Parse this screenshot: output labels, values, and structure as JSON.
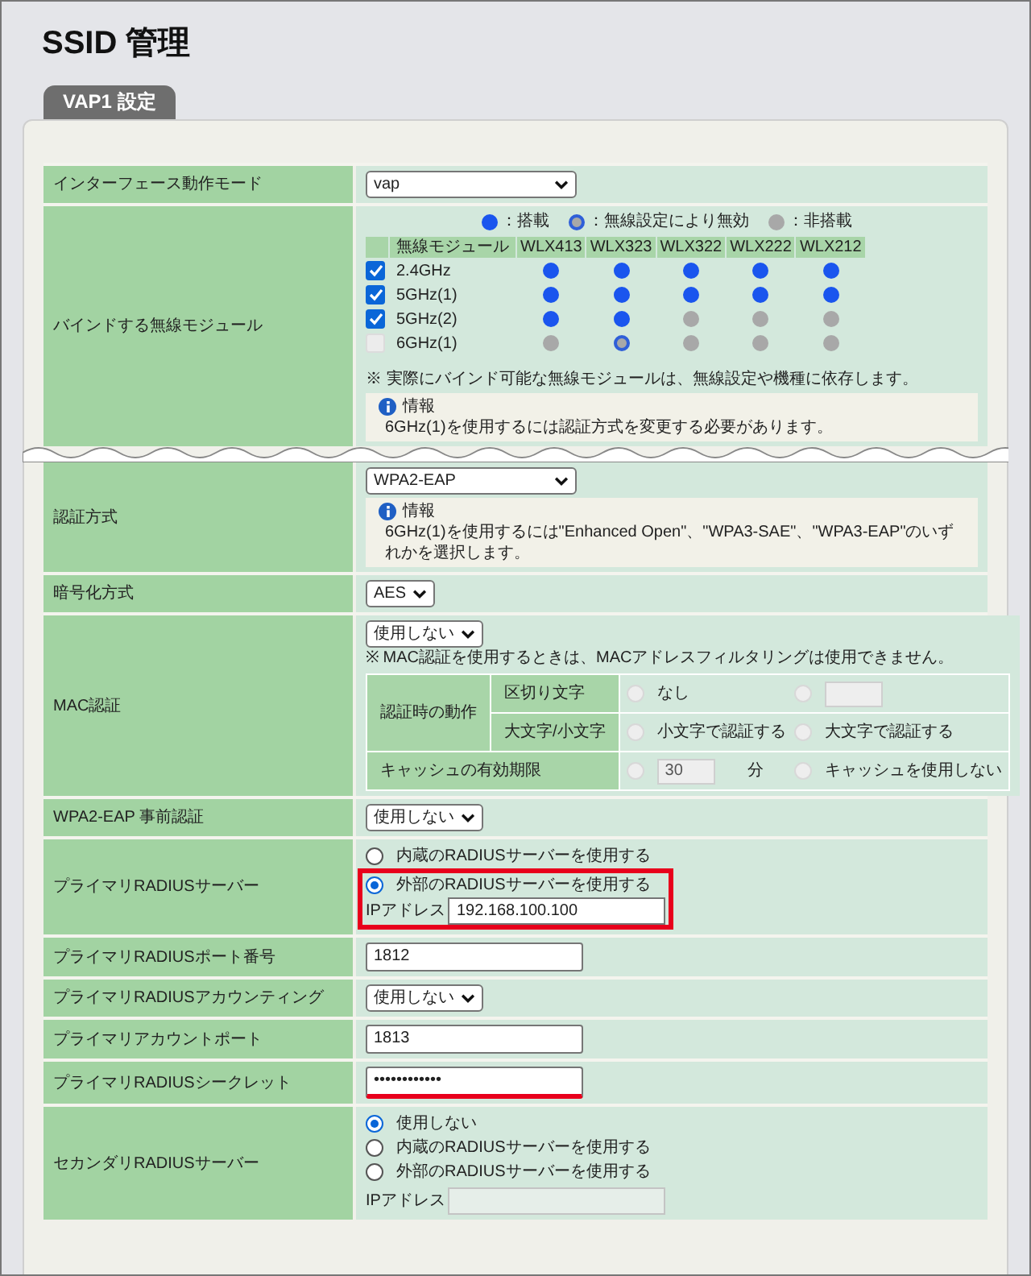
{
  "title": "SSID 管理",
  "tab": {
    "label": "VAP1 設定",
    "selected": true
  },
  "rows": [
    {
      "kind": "select",
      "label": "インターフェース動作モード",
      "value": "vap",
      "wide": true
    },
    {
      "kind": "modules",
      "label": "バインドする無線モジュール",
      "legend": [
        {
          "kind": "on",
          "label": "：搭載"
        },
        {
          "kind": "blocked",
          "label": "：無線設定により無効"
        },
        {
          "kind": "off",
          "label": "：非搭載"
        }
      ],
      "header": "無線モジュール",
      "models": [
        "WLX413",
        "WLX323",
        "WLX322",
        "WLX222",
        "WLX212"
      ],
      "modules": [
        {
          "name": "2.4GHz",
          "checked": true,
          "cells": [
            {
              "kind": "on"
            },
            {
              "kind": "on"
            },
            {
              "kind": "on"
            },
            {
              "kind": "on"
            },
            {
              "kind": "on"
            }
          ]
        },
        {
          "name": "5GHz(1)",
          "checked": true,
          "cells": [
            {
              "kind": "on"
            },
            {
              "kind": "on"
            },
            {
              "kind": "on"
            },
            {
              "kind": "on"
            },
            {
              "kind": "on"
            }
          ]
        },
        {
          "name": "5GHz(2)",
          "checked": true,
          "cells": [
            {
              "kind": "on"
            },
            {
              "kind": "on"
            },
            {
              "kind": "off"
            },
            {
              "kind": "off"
            },
            {
              "kind": "off"
            }
          ]
        },
        {
          "name": "6GHz(1)",
          "checked": false,
          "cells": [
            {
              "kind": "off"
            },
            {
              "kind": "blocked"
            },
            {
              "kind": "off"
            },
            {
              "kind": "off"
            },
            {
              "kind": "off"
            }
          ]
        }
      ],
      "note": "※ 実際にバインド可能な無線モジュールは、無線設定や機種に依存します。",
      "info": {
        "title": "情報",
        "text": "6GHz(1)を使用するには認証方式を変更する必要があります。"
      }
    },
    {
      "kind": "break"
    },
    {
      "kind": "select",
      "label": "認証方式",
      "value": "WPA2-EAP",
      "wide": true,
      "info": {
        "title": "情報",
        "text": "6GHz(1)を使用するには\"Enhanced Open\"、\"WPA3-SAE\"、\"WPA3-EAP\"のいずれかを選択します。"
      }
    },
    {
      "kind": "select",
      "label": "暗号化方式",
      "value": "AES",
      "wide": false
    },
    {
      "kind": "mac",
      "label": "MAC認証",
      "value": "使用しない",
      "note": "※ MAC認証を使用するときは、MACアドレスフィルタリングは使用できません。",
      "group_label": "認証時の動作",
      "disabled": true,
      "lines": [
        {
          "label": "区切り文字",
          "choices": [
            {
              "kind": "text",
              "label": "なし",
              "selected": false
            },
            {
              "kind": "field",
              "selected": false
            }
          ]
        },
        {
          "label": "大文字/小文字",
          "choices": [
            {
              "kind": "text",
              "label": "小文字で認証する",
              "selected": false
            },
            {
              "kind": "text",
              "label": "大文字で認証する",
              "selected": false
            }
          ]
        }
      ],
      "cache": {
        "label": "キャッシュの有効期限",
        "choices": [
          {
            "kind": "field",
            "value": "30",
            "unit": "分",
            "selected": false
          },
          {
            "kind": "text",
            "label": "キャッシュを使用しない",
            "selected": false
          }
        ]
      }
    },
    {
      "kind": "select",
      "label": "WPA2-EAP 事前認証",
      "value": "使用しない",
      "wide": false
    },
    {
      "kind": "radios",
      "label": "プライマリRADIUSサーバー",
      "highlighted": true,
      "options": [
        {
          "label": "内蔵のRADIUSサーバーを使用する",
          "selected": false
        },
        {
          "label": "外部のRADIUSサーバーを使用する",
          "selected": true
        }
      ],
      "address": {
        "label": "IPアドレス",
        "value": "192.168.100.100",
        "disabled": false
      }
    },
    {
      "kind": "input",
      "label": "プライマリRADIUSポート番号",
      "value": "1812",
      "highlighted": false
    },
    {
      "kind": "select",
      "label": "プライマリRADIUSアカウンティング",
      "value": "使用しない",
      "wide": false
    },
    {
      "kind": "input",
      "label": "プライマリアカウントポート",
      "value": "1813",
      "highlighted": false
    },
    {
      "kind": "input",
      "label": "プライマリRADIUSシークレット",
      "value": "••••••••••••",
      "highlighted": true
    },
    {
      "kind": "radios",
      "label": "セカンダリRADIUSサーバー",
      "highlighted": false,
      "options": [
        {
          "label": "使用しない",
          "selected": true
        },
        {
          "label": "内蔵のRADIUSサーバーを使用する",
          "selected": false
        },
        {
          "label": "外部のRADIUSサーバーを使用する",
          "selected": false
        }
      ],
      "address": {
        "label": "IPアドレス",
        "disabled": true
      }
    }
  ]
}
